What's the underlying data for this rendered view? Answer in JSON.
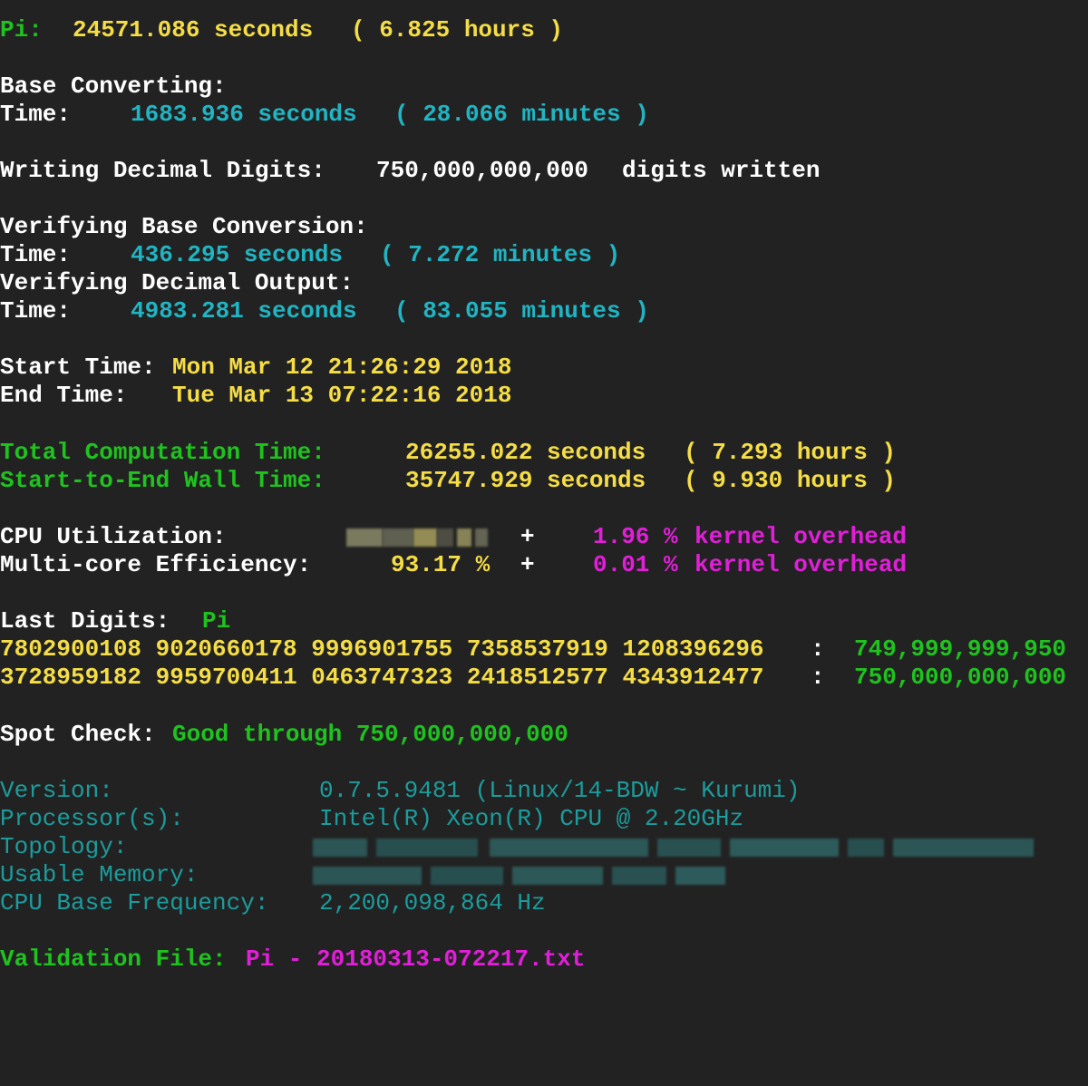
{
  "colors": {
    "background": "#222222",
    "white": "#ffffff",
    "yellow": "#f5dd46",
    "green": "#1fc21f",
    "cyan": "#21b4c2",
    "magenta": "#e11fd9",
    "teal": "#1c9c9c"
  },
  "pi_time": {
    "label": "Pi:",
    "seconds": "24571.086 seconds",
    "hours": "( 6.825 hours )"
  },
  "base_converting": {
    "heading": "Base Converting:",
    "time_label": "Time:",
    "seconds": "1683.936 seconds",
    "minutes": "( 28.066 minutes )"
  },
  "writing_digits": {
    "label": "Writing Decimal Digits:",
    "count": "750,000,000,000",
    "suffix": "digits written"
  },
  "verify_base": {
    "heading": "Verifying Base Conversion:",
    "time_label": "Time:",
    "seconds": "436.295 seconds",
    "minutes": "( 7.272 minutes )"
  },
  "verify_decimal": {
    "heading": "Verifying Decimal Output:",
    "time_label": "Time:",
    "seconds": "4983.281 seconds",
    "minutes": "( 83.055 minutes )"
  },
  "start_time": {
    "label": "Start Time:",
    "value": "Mon Mar 12 21:26:29 2018"
  },
  "end_time": {
    "label": "End Time:",
    "value": "Tue Mar 13 07:22:16 2018"
  },
  "total_computation": {
    "label": "Total Computation Time:",
    "seconds": "26255.022 seconds",
    "hours": "( 7.293 hours )"
  },
  "wall_time": {
    "label": "Start-to-End Wall Time:",
    "seconds": "35747.929 seconds",
    "hours": "( 9.930 hours )"
  },
  "cpu_utilization": {
    "label": "CPU Utilization:",
    "plus": "+",
    "kernel_value": "1.96 %",
    "kernel_label": "kernel overhead"
  },
  "multicore": {
    "label": "Multi-core Efficiency:",
    "value": "93.17 %",
    "plus": "+",
    "kernel_value": "0.01 %",
    "kernel_label": "kernel overhead"
  },
  "last_digits": {
    "label": "Last Digits:",
    "constant": "Pi",
    "rows": [
      {
        "digits": "7802900108 9020660178 9996901755 7358537919 1208396296",
        "sep": ":",
        "position": "749,999,999,950"
      },
      {
        "digits": "3728959182 9959700411 0463747323 2418512577 4343912477",
        "sep": ":",
        "position": "750,000,000,000"
      }
    ]
  },
  "spot_check": {
    "label": "Spot Check:",
    "value": "Good through 750,000,000,000"
  },
  "system_info": {
    "version_label": "Version:",
    "version_value": "0.7.5.9481 (Linux/14-BDW ~ Kurumi)",
    "processor_label": "Processor(s):",
    "processor_value": "Intel(R) Xeon(R) CPU @ 2.20GHz",
    "topology_label": "Topology:",
    "memory_label": "Usable Memory:",
    "frequency_label": "CPU Base Frequency:",
    "frequency_value": "2,200,098,864 Hz"
  },
  "validation_file": {
    "label": "Validation File:",
    "value": "Pi - 20180313-072217.txt"
  }
}
